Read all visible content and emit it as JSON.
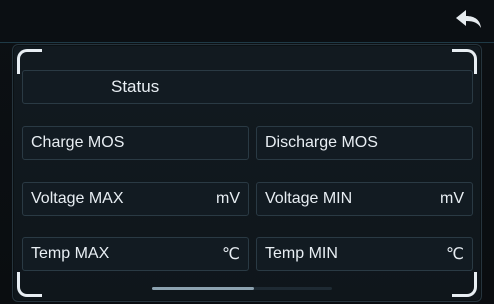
{
  "header": {
    "back_icon": "back-arrow-icon"
  },
  "status": {
    "label": "Status"
  },
  "rows": {
    "charge_mos": {
      "label": "Charge MOS"
    },
    "discharge_mos": {
      "label": "Discharge MOS"
    },
    "voltage_max": {
      "label": "Voltage MAX",
      "unit": "mV"
    },
    "voltage_min": {
      "label": "Voltage MIN",
      "unit": "mV"
    },
    "temp_max": {
      "label": "Temp MAX",
      "unit": "℃"
    },
    "temp_min": {
      "label": "Temp MIN",
      "unit": "℃"
    }
  },
  "colors": {
    "accent": "#8ca2b0",
    "panel_border": "#26343d"
  }
}
